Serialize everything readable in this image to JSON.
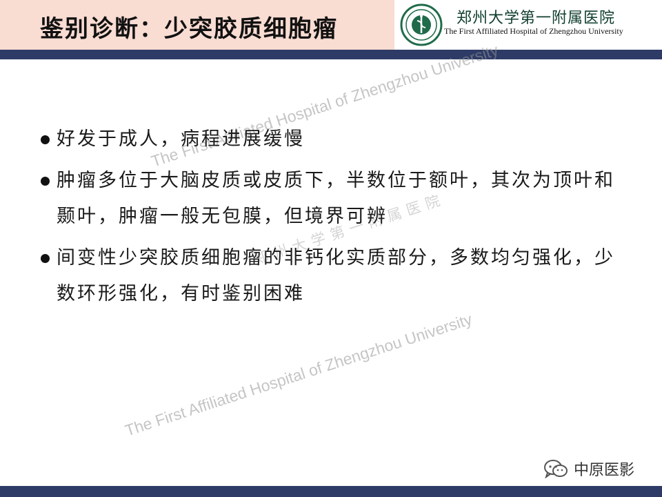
{
  "header": {
    "title": "鉴别诊断：少突胶质细胞瘤",
    "hospital_name_cn": "郑州大学第一附属医院",
    "hospital_name_en": "The First Affiliated Hospital of Zhengzhou University",
    "logo_icon": "hospital-emblem-icon"
  },
  "content": {
    "bullets": [
      "好发于成人，病程进展缓慢",
      "肿瘤多位于大脑皮质或皮质下，半数位于额叶，其次为顶叶和颞叶，肿瘤一般无包膜，但境界可辨",
      "间变性少突胶质细胞瘤的非钙化实质部分，多数均匀强化，少数环形强化，有时鉴别困难"
    ]
  },
  "watermarks": {
    "en_top": "The First Affiliated Hospital of Zhengzhou University",
    "cn_mid": "郑州大学第一附属医院",
    "en_bottom": "The First  Affiliated Hospital of Zhengzhou University"
  },
  "footer": {
    "wechat_label": "中原医影",
    "wechat_icon": "wechat-icon"
  },
  "colors": {
    "title_bar": "#f9dcd2",
    "stripe": "#2d3b66",
    "logo_green": "#1f6b4a"
  }
}
